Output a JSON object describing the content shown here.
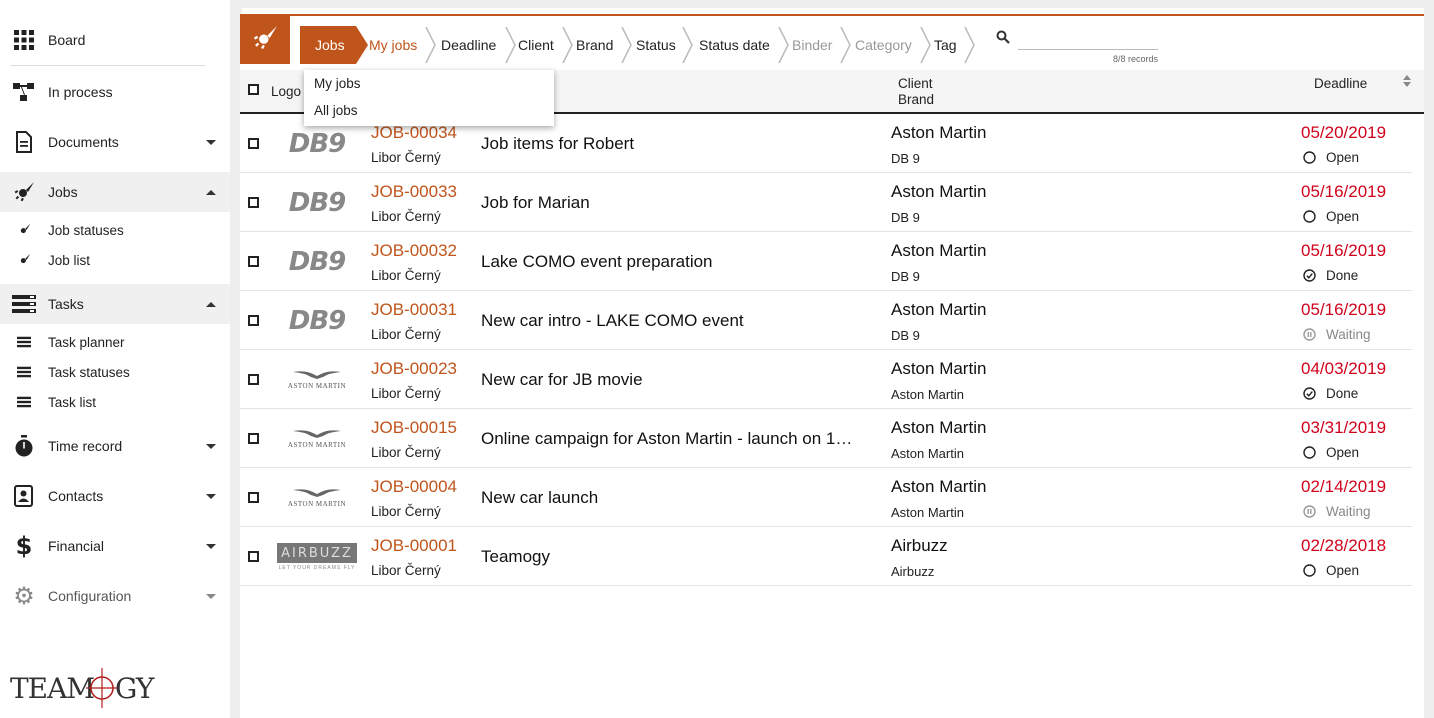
{
  "sidebar": {
    "items": [
      {
        "label": "Board",
        "icon": "grid-icon"
      },
      {
        "label": "In process",
        "icon": "flow-icon"
      },
      {
        "label": "Documents",
        "icon": "document-icon"
      },
      {
        "label": "Jobs",
        "icon": "rocket-icon"
      },
      {
        "label": "Tasks",
        "icon": "tasks-icon"
      },
      {
        "label": "Time record",
        "icon": "stopwatch-icon"
      },
      {
        "label": "Contacts",
        "icon": "contact-book-icon"
      },
      {
        "label": "Financial",
        "icon": "dollar-icon"
      },
      {
        "label": "Configuration",
        "icon": "gear-icon"
      }
    ],
    "jobs_sub": [
      {
        "label": "Job statuses"
      },
      {
        "label": "Job list"
      }
    ],
    "tasks_sub": [
      {
        "label": "Task planner"
      },
      {
        "label": "Task statuses"
      },
      {
        "label": "Task list"
      }
    ],
    "logo_text": "TEAMOGY"
  },
  "breadcrumbs": [
    {
      "label": "Jobs"
    },
    {
      "label": "My jobs"
    },
    {
      "label": "Deadline"
    },
    {
      "label": "Client"
    },
    {
      "label": "Brand"
    },
    {
      "label": "Status"
    },
    {
      "label": "Status date"
    },
    {
      "label": "Binder"
    },
    {
      "label": "Category"
    },
    {
      "label": "Tag"
    }
  ],
  "search": {
    "value": "",
    "placeholder": ""
  },
  "records": "8/8 records",
  "dropdown": [
    {
      "label": "My jobs"
    },
    {
      "label": "All jobs"
    }
  ],
  "header": {
    "logo": "Logo",
    "client": "Client",
    "brand": "Brand",
    "deadline": "Deadline"
  },
  "rows": [
    {
      "code": "JOB-00034",
      "owner": "Libor Černý",
      "title": "Job items for Robert",
      "client": "Aston Martin",
      "brand": "DB 9",
      "deadline": "05/20/2019",
      "status": "Open",
      "logo": "DB9"
    },
    {
      "code": "JOB-00033",
      "owner": "Libor Černý",
      "title": "Job for Marian",
      "client": "Aston Martin",
      "brand": "DB 9",
      "deadline": "05/16/2019",
      "status": "Open",
      "logo": "DB9"
    },
    {
      "code": "JOB-00032",
      "owner": "Libor Černý",
      "title": "Lake COMO event preparation",
      "client": "Aston Martin",
      "brand": "DB 9",
      "deadline": "05/16/2019",
      "status": "Done",
      "logo": "DB9"
    },
    {
      "code": "JOB-00031",
      "owner": "Libor Černý",
      "title": "New car intro - LAKE COMO event",
      "client": "Aston Martin",
      "brand": "DB 9",
      "deadline": "05/16/2019",
      "status": "Waiting",
      "logo": "DB9"
    },
    {
      "code": "JOB-00023",
      "owner": "Libor Černý",
      "title": "New car for JB movie",
      "client": "Aston Martin",
      "brand": "Aston Martin",
      "deadline": "04/03/2019",
      "status": "Done",
      "logo": "ASTON MARTIN"
    },
    {
      "code": "JOB-00015",
      "owner": "Libor Černý",
      "title": "Online campaign for Aston Martin - launch on 1…",
      "client": "Aston Martin",
      "brand": "Aston Martin",
      "deadline": "03/31/2019",
      "status": "Open",
      "logo": "ASTON MARTIN"
    },
    {
      "code": "JOB-00004",
      "owner": "Libor Černý",
      "title": "New car launch",
      "client": "Aston Martin",
      "brand": "Aston Martin",
      "deadline": "02/14/2019",
      "status": "Waiting",
      "logo": "ASTON MARTIN"
    },
    {
      "code": "JOB-00001",
      "owner": "Libor Černý",
      "title": "Teamogy",
      "client": "Airbuzz",
      "brand": "Airbuzz",
      "deadline": "02/28/2018",
      "status": "Open",
      "logo": "AIRBUZZ"
    }
  ],
  "airbuzz_tagline": "LET YOUR DREAMS FLY",
  "colors": {
    "accent": "#c0551c",
    "deadline": "#d0021b"
  }
}
